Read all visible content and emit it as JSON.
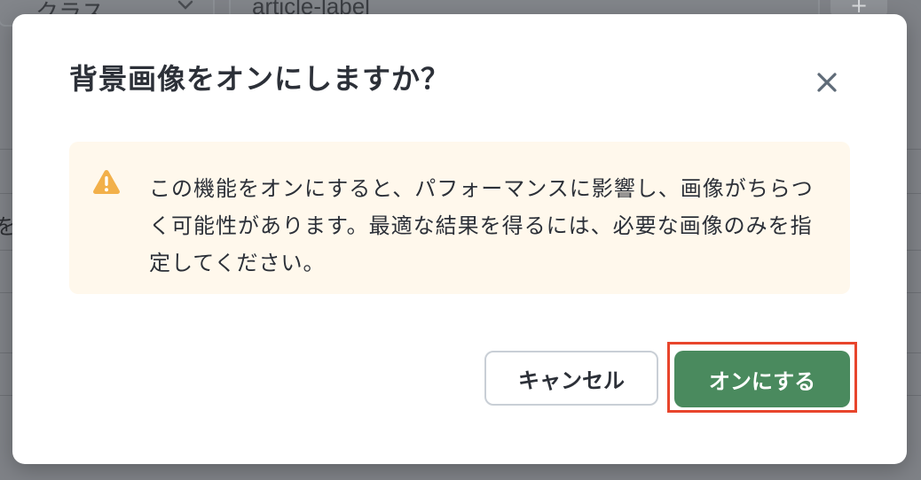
{
  "background": {
    "class_select_label": "クラス",
    "class_input_value": "article-label",
    "add_button_label": "+",
    "edge_glyph": "を"
  },
  "dialog": {
    "title": "背景画像をオンにしますか？",
    "close_icon": "close-icon",
    "warning": {
      "icon": "warning-triangle-icon",
      "text": "この機能をオンにすると、パフォーマンスに影響し、画像がちらつく可能性があります。最適な結果を得るには、必要な画像のみを指定してください。"
    },
    "cancel_label": "キャンセル",
    "confirm_label": "オンにする"
  },
  "colors": {
    "confirm": "#4a8a5e",
    "warning_icon": "#f2b04a",
    "warning_background": "#fff8ec",
    "highlight": "#e8452c",
    "overlay": "#7f8287"
  }
}
